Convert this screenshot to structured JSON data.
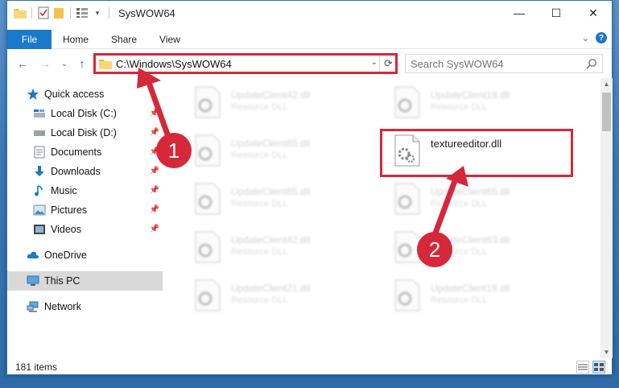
{
  "window": {
    "title": "SysWOW64",
    "controls": {
      "minimize": "—",
      "maximize": "☐",
      "close": "✕"
    }
  },
  "ribbon": {
    "tabs": [
      "File",
      "Home",
      "Share",
      "View"
    ],
    "expand_icon": "chevron-down-icon",
    "help_label": "?"
  },
  "address": {
    "path": "C:\\Windows\\SysWOW64",
    "back": "←",
    "forward": "→",
    "recent": "⌄",
    "up": "↑",
    "refresh": "⟳",
    "dropdown": "⌄"
  },
  "search": {
    "placeholder": "Search SysWOW64"
  },
  "nav": {
    "items": [
      {
        "label": "Quick access",
        "icon": "star-icon",
        "pinned": false
      },
      {
        "label": "Local Disk (C:)",
        "icon": "drive-icon",
        "pinned": true
      },
      {
        "label": "Local Disk (D:)",
        "icon": "drive-icon",
        "pinned": true
      },
      {
        "label": "Documents",
        "icon": "documents-icon",
        "pinned": true
      },
      {
        "label": "Downloads",
        "icon": "download-icon",
        "pinned": true
      },
      {
        "label": "Music",
        "icon": "music-icon",
        "pinned": true
      },
      {
        "label": "Pictures",
        "icon": "pictures-icon",
        "pinned": true
      },
      {
        "label": "Videos",
        "icon": "video-icon",
        "pinned": true
      },
      {
        "label": "OneDrive",
        "icon": "cloud-icon",
        "pinned": false
      },
      {
        "label": "This PC",
        "icon": "computer-icon",
        "pinned": false,
        "selected": true
      },
      {
        "label": "Network",
        "icon": "network-icon",
        "pinned": false
      }
    ]
  },
  "files": {
    "left": [
      {
        "name": "UpdateClient42.dll",
        "type": "Resource DLL"
      },
      {
        "name": "UpdateClient65.dll",
        "type": "Resource DLL"
      },
      {
        "name": "UpdateClient65.dll",
        "type": "Resource DLL"
      },
      {
        "name": "UpdateClient42.dll",
        "type": "Resource DLL"
      },
      {
        "name": "UpdateClient21.dll",
        "type": "Resource DLL"
      }
    ],
    "right": [
      {
        "name": "UpdateClient19.dll",
        "type": "Resource DLL"
      },
      {
        "name": "textureeditor.dll",
        "type": "",
        "focus": true
      },
      {
        "name": "UpdateClient65.dll",
        "type": "Resource DLL"
      },
      {
        "name": "UpdateClient63.dll",
        "type": "Resource DLL"
      },
      {
        "name": "UpdateClient19.dll",
        "type": "Resource DLL"
      }
    ]
  },
  "status": {
    "item_count": "181 items"
  },
  "annotations": {
    "marker1": "1",
    "marker2": "2",
    "color": "#d6283a"
  },
  "colors": {
    "accent": "#1979ca",
    "highlight": "#d6283a"
  }
}
